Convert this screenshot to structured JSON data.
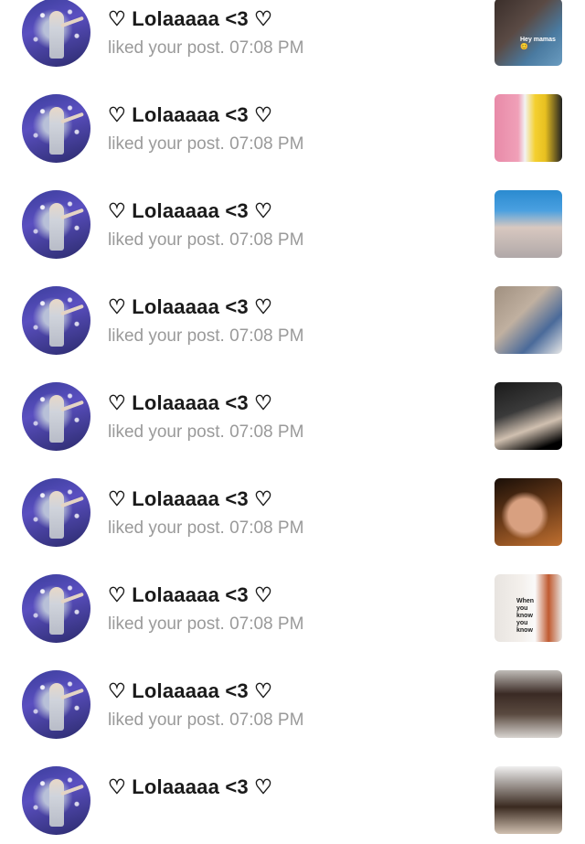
{
  "notifications": [
    {
      "title": "♡ Lolaaaaa <3 ♡",
      "subtitle": "liked your post. 07:08 PM",
      "thumb_caption": "Hey mamas 😊"
    },
    {
      "title": "♡ Lolaaaaa <3 ♡",
      "subtitle": "liked your post. 07:08 PM",
      "thumb_caption": ""
    },
    {
      "title": "♡ Lolaaaaa <3 ♡",
      "subtitle": "liked your post. 07:08 PM",
      "thumb_caption": ""
    },
    {
      "title": "♡ Lolaaaaa <3 ♡",
      "subtitle": "liked your post. 07:08 PM",
      "thumb_caption": ""
    },
    {
      "title": "♡ Lolaaaaa <3 ♡",
      "subtitle": "liked your post. 07:08 PM",
      "thumb_caption": ""
    },
    {
      "title": "♡ Lolaaaaa <3 ♡",
      "subtitle": "liked your post. 07:08 PM",
      "thumb_caption": ""
    },
    {
      "title": "♡ Lolaaaaa <3 ♡",
      "subtitle": "liked your post. 07:08 PM",
      "thumb_caption": "When you know you know"
    },
    {
      "title": "♡ Lolaaaaa <3 ♡",
      "subtitle": "liked your post. 07:08 PM",
      "thumb_caption": ""
    },
    {
      "title": "♡ Lolaaaaa <3 ♡",
      "subtitle": "",
      "thumb_caption": ""
    }
  ]
}
